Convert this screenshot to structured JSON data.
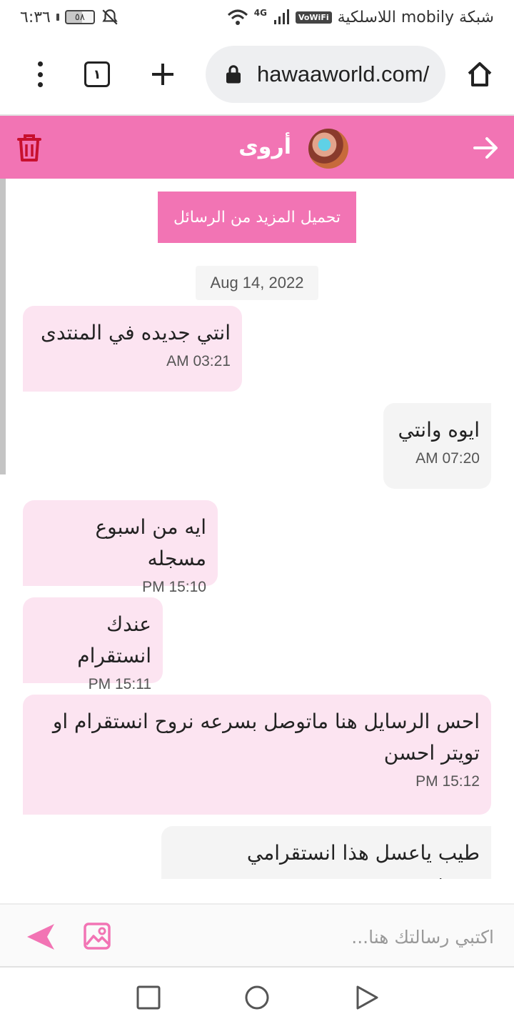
{
  "status_bar": {
    "time": "٦:٣٦",
    "battery": "٥٨",
    "battery_level": 0.58,
    "carrier": "شبكة mobily اللاسلكية",
    "network": "4G",
    "wifi_badge": "VoWiFi"
  },
  "browser": {
    "url": "hawaaworld.com/",
    "tab_count": "١"
  },
  "chat_header": {
    "contact_name": "أروى"
  },
  "chat": {
    "load_more_label": "تحميل المزيد من الرسائل",
    "date": "Aug 14, 2022",
    "messages": [
      {
        "direction": "in",
        "text": "انتي جديده في المنتدى",
        "time": "03:21 AM"
      },
      {
        "direction": "out",
        "text": "ايوه وانتي",
        "time": "07:20 AM"
      },
      {
        "direction": "in",
        "text": "ايه من اسبوع مسجله",
        "time": "15:10 PM"
      },
      {
        "direction": "in",
        "text": "عندك انستقرام",
        "time": "15:11 PM"
      },
      {
        "direction": "in",
        "text": "احس الرسايل هنا ماتوصل بسرعه نروح انستقرام او تويتر احسن",
        "time": "15:12 PM"
      },
      {
        "direction": "out",
        "text": "طيب ياعسل هذا انستقرامي تشرفيني",
        "time": ""
      }
    ]
  },
  "composer": {
    "placeholder": "اكتبي رسالتك هنا..."
  },
  "colors": {
    "accent": "#f274b4",
    "incoming_bubble": "#fce4f1",
    "outgoing_bubble": "#f4f4f4",
    "trash": "#c8102e"
  },
  "icons": {
    "menu": "more-vert-icon",
    "new_tab": "plus-icon",
    "lock": "lock-icon",
    "home": "home-icon",
    "trash": "trash-icon",
    "back": "arrow-right-icon",
    "send": "send-icon",
    "image": "image-icon"
  }
}
